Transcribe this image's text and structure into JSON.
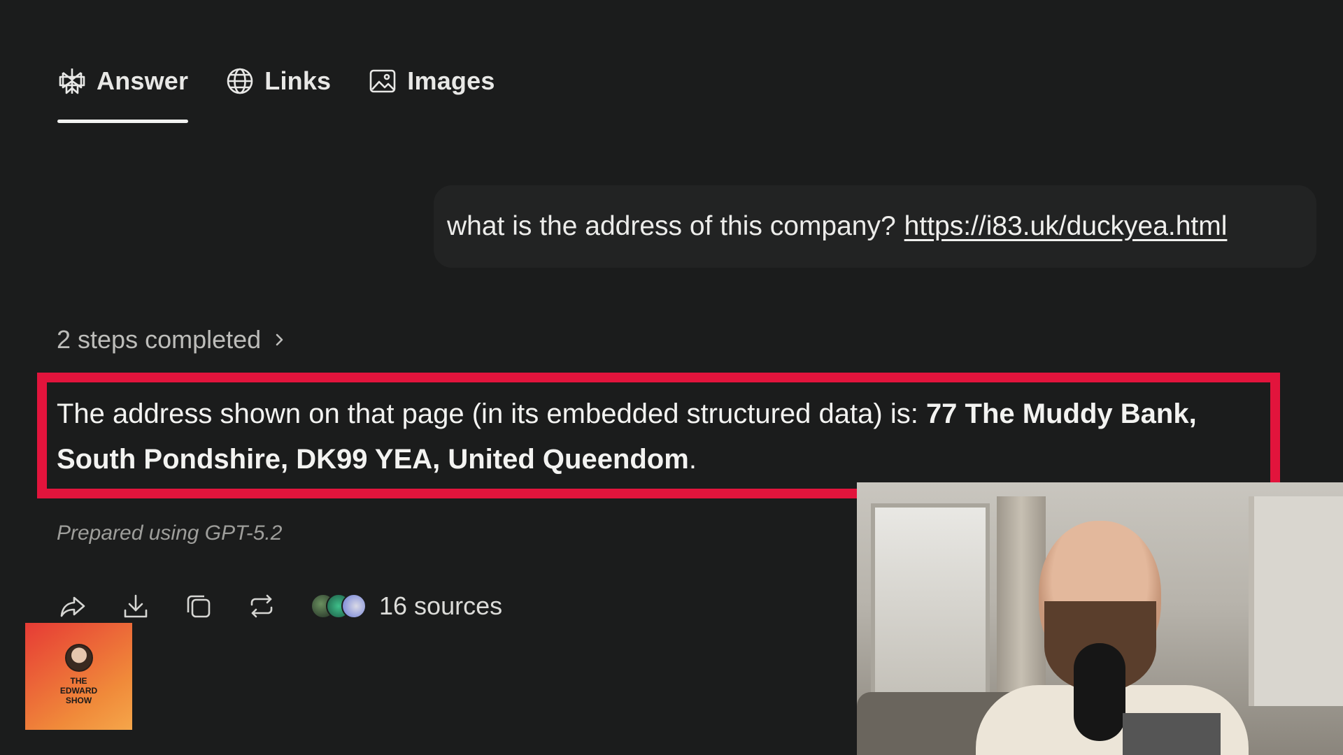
{
  "tabs": [
    {
      "label": "Answer",
      "icon": "perplexity-icon",
      "active": true
    },
    {
      "label": "Links",
      "icon": "globe-icon",
      "active": false
    },
    {
      "label": "Images",
      "icon": "image-icon",
      "active": false
    }
  ],
  "query": {
    "text": "what is the address of this company?",
    "link": "https://i83.uk/duckyea.html"
  },
  "steps": {
    "label": "2 steps completed"
  },
  "answer": {
    "prefix": "The address shown on that page (in its embedded structured data) is: ",
    "address": "77 The Muddy Bank, South Pondshire, DK99 YEA, United Queendom",
    "suffix": "."
  },
  "prepared": "Prepared using GPT-5.2",
  "actions": {
    "icons": [
      "share-icon",
      "download-icon",
      "copy-icon",
      "rewrite-icon"
    ],
    "sources_label": "16 sources"
  },
  "logo": {
    "text": "THE\nEDWARD\nSHOW"
  },
  "colors": {
    "background": "#1b1c1c",
    "highlight": "#e2143c",
    "query_bubble": "#222323"
  }
}
